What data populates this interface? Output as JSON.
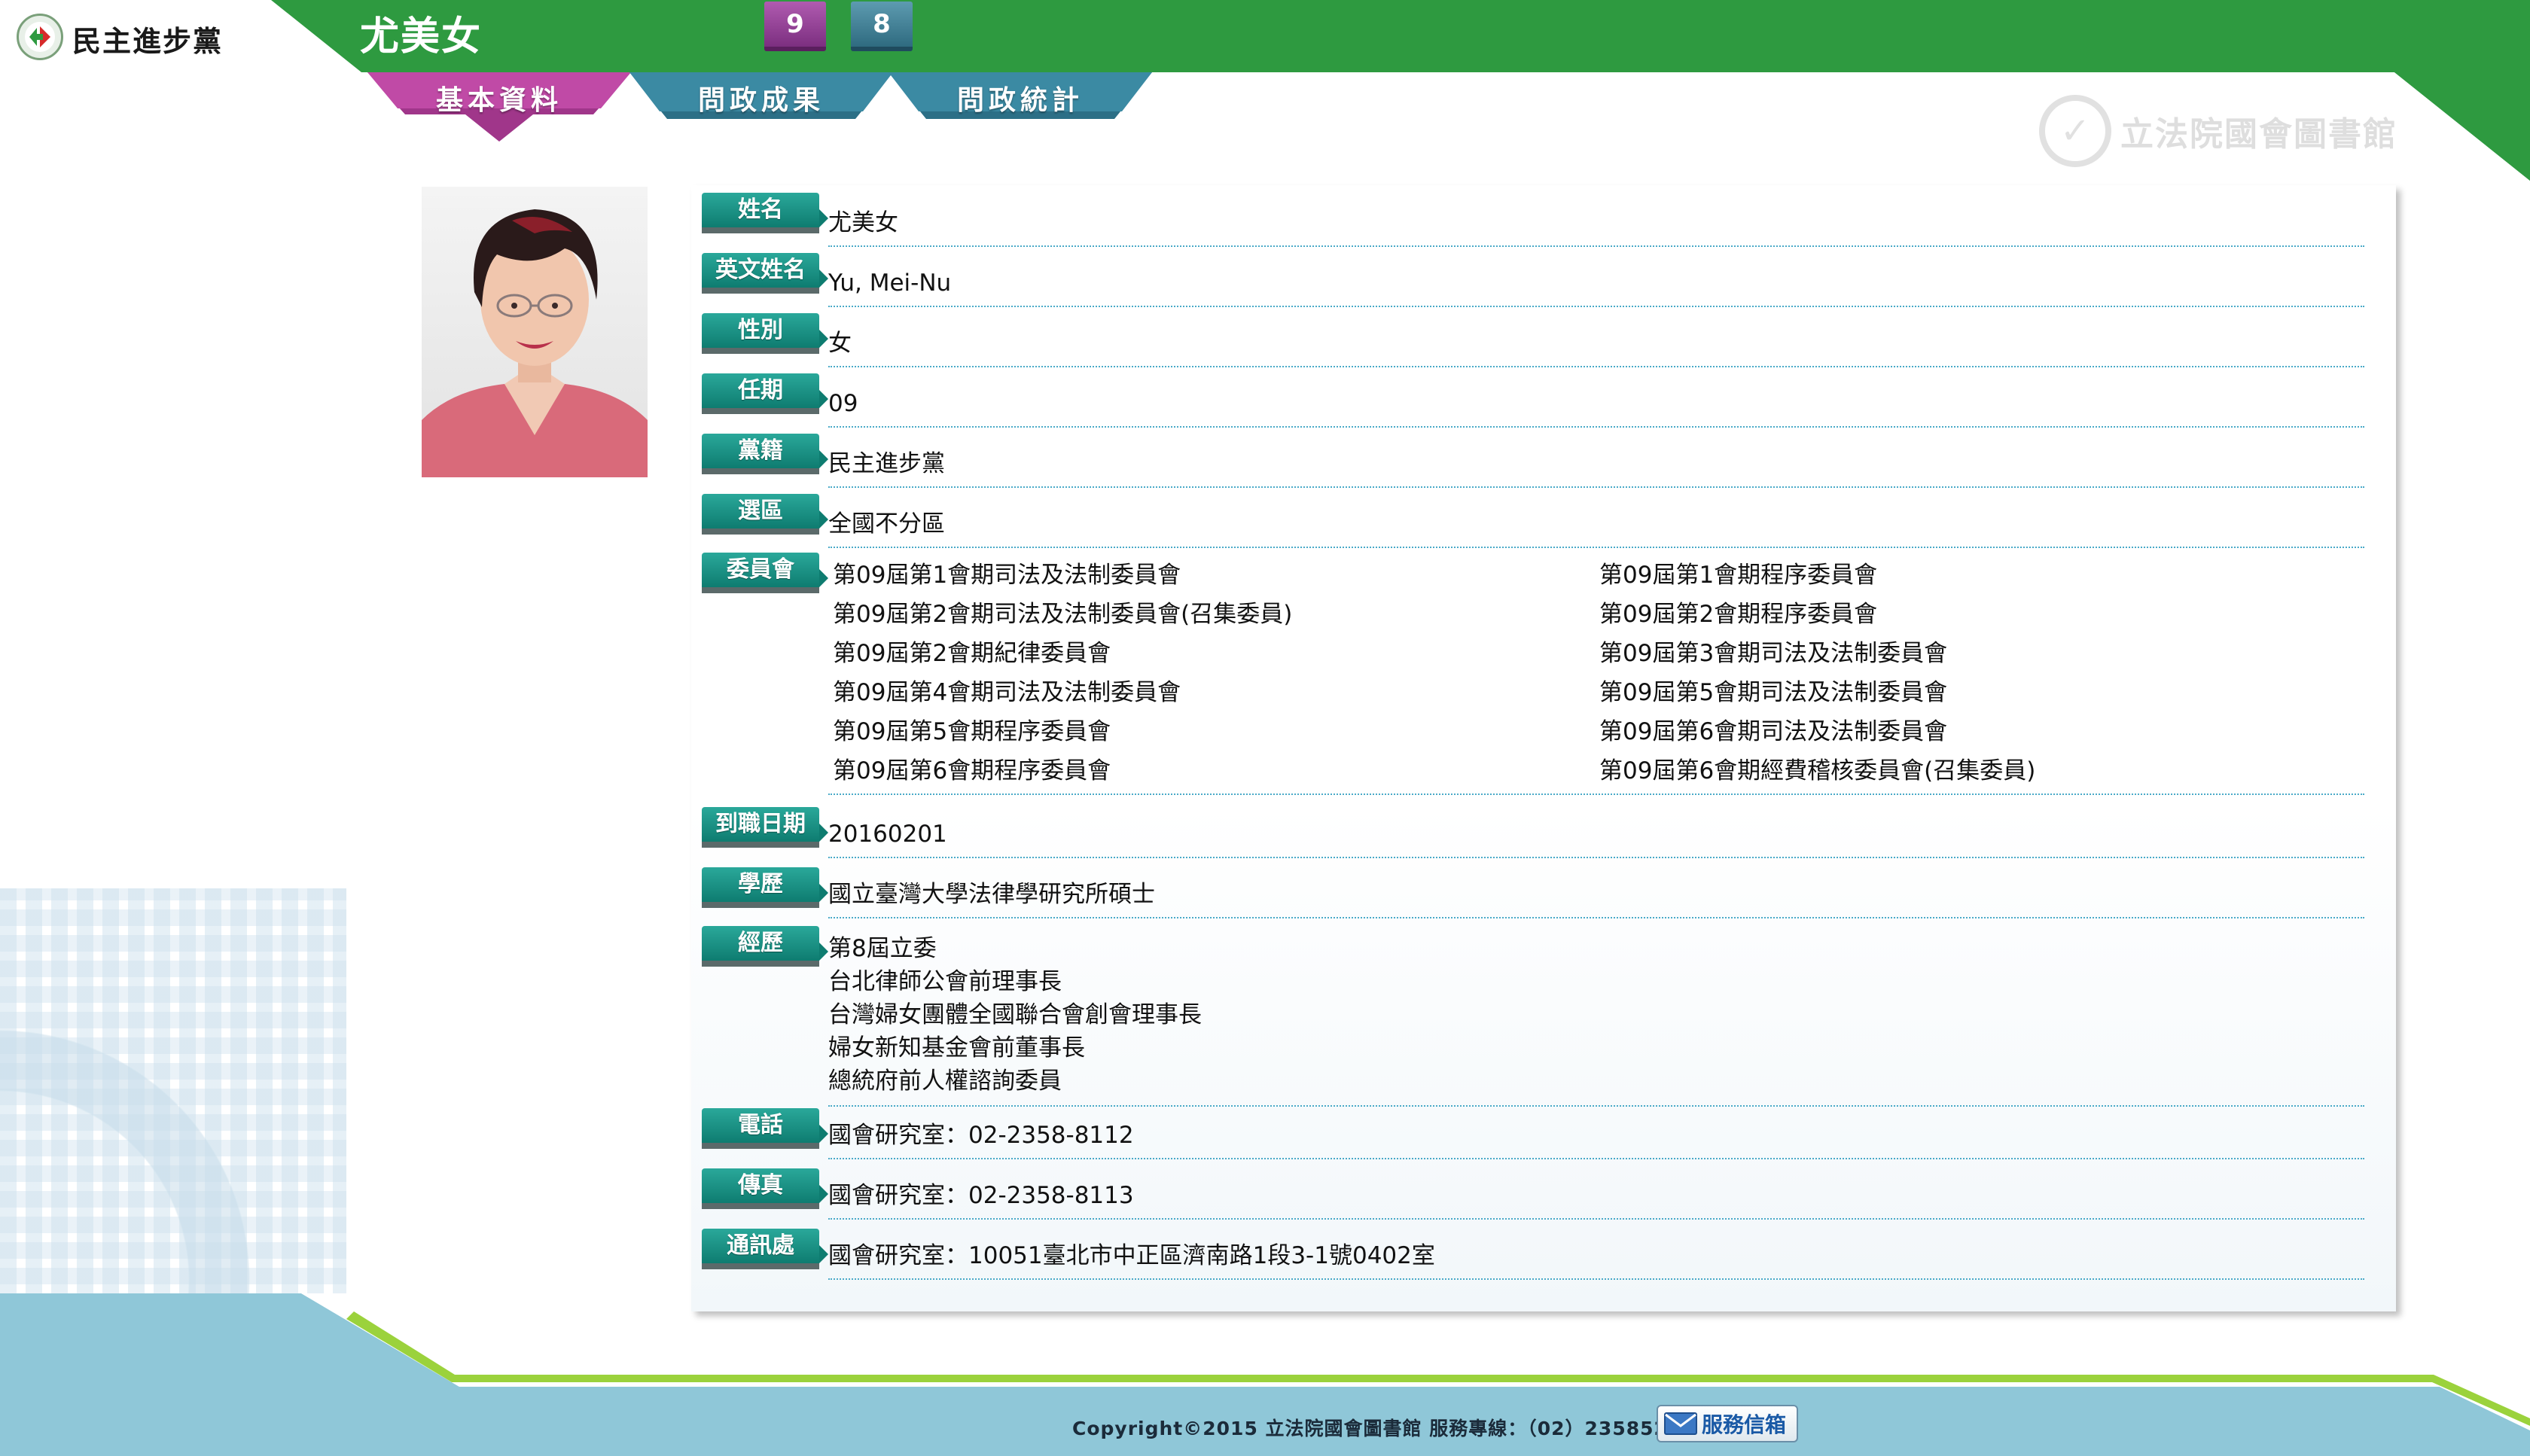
{
  "header": {
    "party_name": "民主進步黨",
    "member_name": "尤美女",
    "terms": [
      "9",
      "8"
    ],
    "colors": {
      "green": "#2e9a40",
      "purple": "#8a3a8e",
      "teal": "#3a7d90"
    }
  },
  "tabs": [
    {
      "label": "基本資料",
      "active": true
    },
    {
      "label": "問政成果",
      "active": false
    },
    {
      "label": "問政統計",
      "active": false
    }
  ],
  "library": {
    "name": "立法院國會圖書館",
    "icon": "library-logo-icon"
  },
  "profile": {
    "name": {
      "label": "姓名",
      "value": "尤美女"
    },
    "english_name": {
      "label": "英文姓名",
      "value": "Yu, Mei-Nu"
    },
    "gender": {
      "label": "性別",
      "value": "女"
    },
    "term": {
      "label": "任期",
      "value": "09"
    },
    "party": {
      "label": "黨籍",
      "value": "民主進步黨"
    },
    "district": {
      "label": "選區",
      "value": "全國不分區"
    },
    "committees": {
      "label": "委員會",
      "left": [
        "第09屆第1會期司法及法制委員會",
        "第09屆第2會期司法及法制委員會(召集委員)",
        "第09屆第2會期紀律委員會",
        "第09屆第4會期司法及法制委員會",
        "第09屆第5會期程序委員會",
        "第09屆第6會期程序委員會"
      ],
      "right": [
        "第09屆第1會期程序委員會",
        "第09屆第2會期程序委員會",
        "第09屆第3會期司法及法制委員會",
        "第09屆第5會期司法及法制委員會",
        "第09屆第6會期司法及法制委員會",
        "第09屆第6會期經費稽核委員會(召集委員)"
      ]
    },
    "start_date": {
      "label": "到職日期",
      "value": "20160201"
    },
    "education": {
      "label": "學歷",
      "value": "國立臺灣大學法律學研究所碩士"
    },
    "experience": {
      "label": "經歷",
      "items": [
        "第8屆立委",
        "台北律師公會前理事長",
        "台灣婦女團體全國聯合會創會理事長",
        "婦女新知基金會前董事長",
        "總統府前人權諮詢委員"
      ]
    },
    "phone": {
      "label": "電話",
      "value": "國會研究室：02-2358-8112"
    },
    "fax": {
      "label": "傳真",
      "value": "國會研究室：02-2358-8113"
    },
    "address": {
      "label": "通訊處",
      "value": "國會研究室：10051臺北市中正區濟南路1段3-1號0402室"
    }
  },
  "footer": {
    "copyright": "Copyright©2015 立法院國會圖書館 服務專線：（02）23585278",
    "mail_button": "服務信箱",
    "mail_icon": "envelope-icon"
  }
}
